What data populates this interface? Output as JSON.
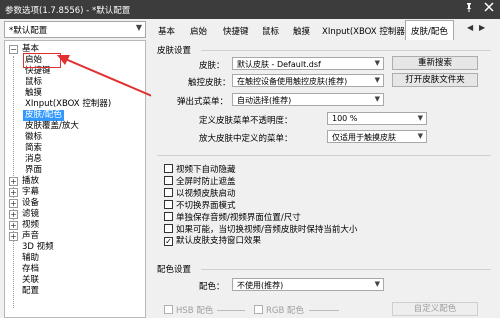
{
  "window": {
    "title": "参数选项(1.7.8556) - *默认配置",
    "pin_icon": "pin-icon",
    "close_icon": "close-icon"
  },
  "toolbar": {
    "preset_value": "*默认配置",
    "tabs": [
      "基本",
      "启始",
      "快捷键",
      "鼠标",
      "触摸",
      "XInput(XBOX 控制器)",
      "皮肤/配色"
    ],
    "active_tab": "皮肤/配色"
  },
  "sidebar": {
    "root": "基本",
    "children": [
      "启始",
      "快捷键",
      "鼠标",
      "触摸",
      "XInput(XBOX 控制器)",
      "皮肤/配色",
      "皮肤覆盖/放大",
      "徽标",
      "简索",
      "消息",
      "界面"
    ],
    "selected": "皮肤/配色",
    "groups": [
      "播放",
      "字幕",
      "设备",
      "滤镜",
      "视频",
      "声音"
    ],
    "leaves": [
      "3D 视频",
      "辅助",
      "存档",
      "关联",
      "配置"
    ]
  },
  "skin": {
    "section_title": "皮肤设置",
    "skin_label": "皮肤：",
    "skin_value": "默认皮肤 - Default.dsf",
    "reset_button": "重新搜索",
    "touch_skin_label": "触控皮肤：",
    "touch_skin_value": "在触控设备使用触控皮肤(推荐)",
    "open_folder_button": "打开皮肤文件夹",
    "popup_menu_label": "弹出式菜单：",
    "popup_menu_value": "自动选择(推荐)",
    "opacity_label": "定义皮肤菜单不透明度：",
    "opacity_value": "100 %",
    "zoom_label": "放大皮肤中定义的菜单：",
    "zoom_value": "仅适用于触摸皮肤"
  },
  "options": [
    {
      "label": "视频下自动隐藏",
      "checked": false
    },
    {
      "label": "全屏时防止遮盖",
      "checked": false
    },
    {
      "label": "以视频皮肤启动",
      "checked": false
    },
    {
      "label": "不切换界面模式",
      "checked": false
    },
    {
      "label": "单独保存音频/视频界面位置/尺寸",
      "checked": false
    },
    {
      "label": "如果可能，当切换视频/音频皮肤时保持当前大小",
      "checked": false
    },
    {
      "label": "默认皮肤支持窗口效果",
      "checked": true
    }
  ],
  "color": {
    "section_title": "配色设置",
    "scheme_label": "配色：",
    "scheme_value": "不使用(推荐)",
    "hsb_label": "HSB 配色",
    "rgb_label": "RGB 配色",
    "custom_button": "自定义配色"
  },
  "colors": {
    "titlebar": "#3c3c3c",
    "selection": "#3399ff",
    "annotation": "#e03030"
  }
}
